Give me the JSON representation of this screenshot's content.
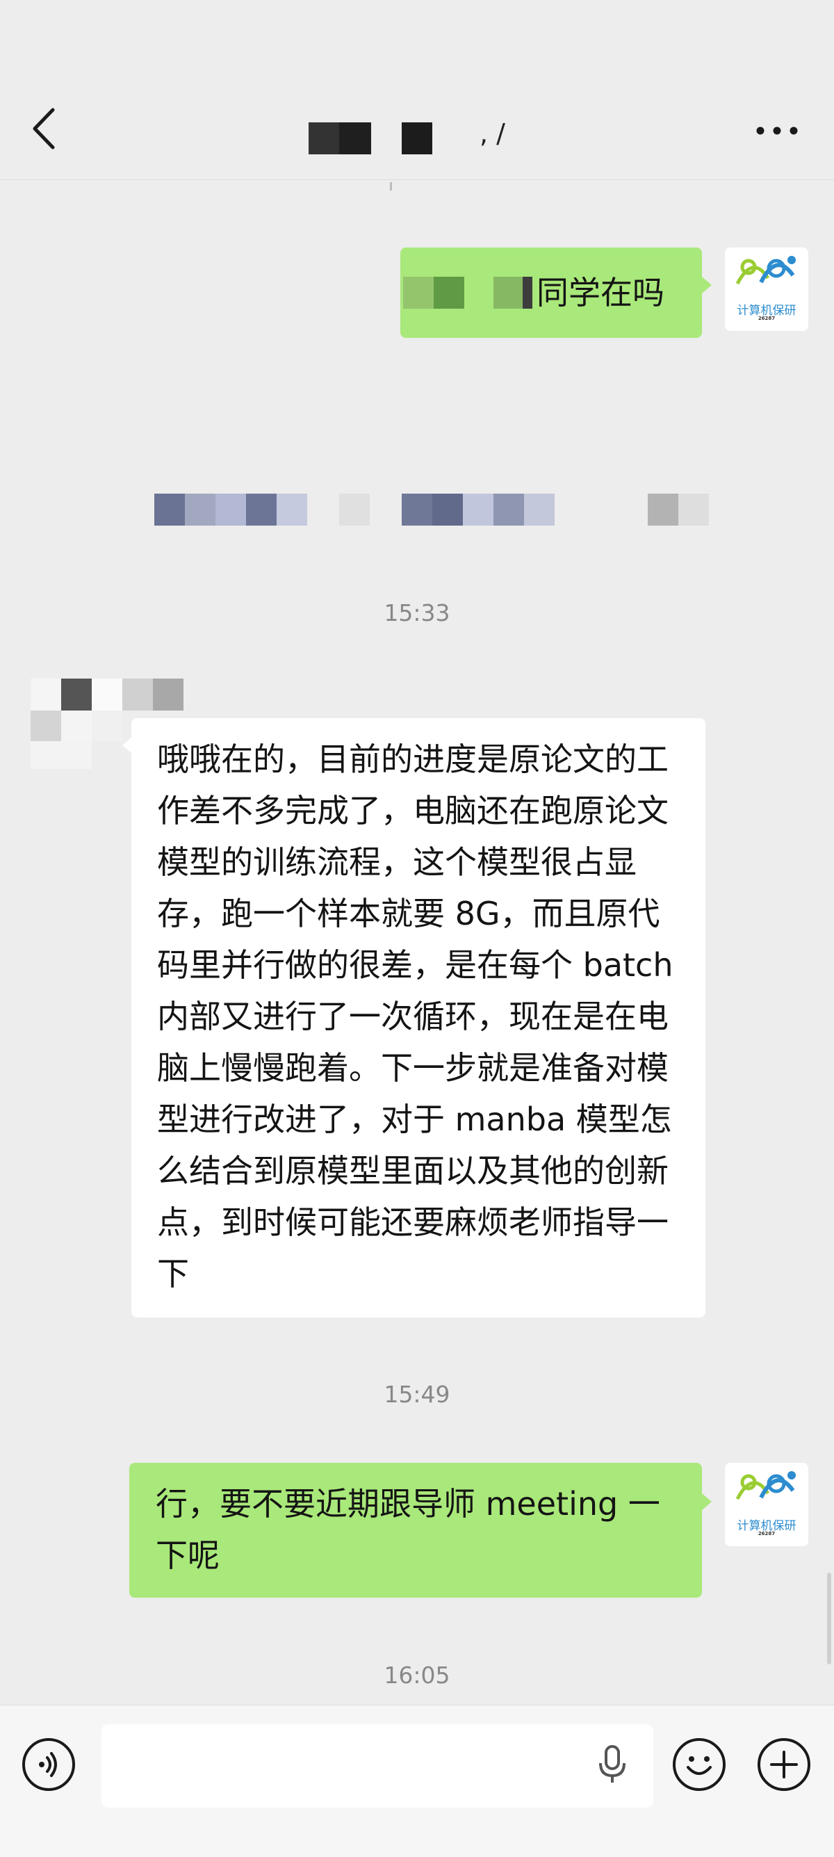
{
  "header": {
    "title": ", /"
  },
  "messages": [
    {
      "side": "right",
      "text": "同学在吗"
    },
    {
      "side": "left",
      "text": "哦哦在的，目前的进度是原论文的工作差不多完成了，电脑还在跑原论文模型的训练流程，这个模型很占显存，跑一个样本就要 8G，而且原代码里并行做的很差，是在每个 batch 内部又进行了一次循环，现在是在电脑上慢慢跑着。下一步就是准备对模型进行改进了，对于 manba 模型怎么结合到原模型里面以及其他的创新点，到时候可能还要麻烦老师指导一下"
    },
    {
      "side": "right",
      "text": "行，要不要近期跟导师 meeting 一下呢"
    }
  ],
  "timestamps": [
    "15:33",
    "15:49",
    "16:05"
  ],
  "avatar": {
    "label": "计算机保研",
    "sub": "26287"
  },
  "input": {
    "value": ""
  },
  "icons": [
    "back-arrow-icon",
    "more-icon",
    "voice-icon",
    "mic-icon",
    "emoji-icon",
    "plus-icon"
  ],
  "colors": {
    "green_bubble": "#a9e87a",
    "background": "#ededed",
    "white_bubble": "#ffffff"
  }
}
